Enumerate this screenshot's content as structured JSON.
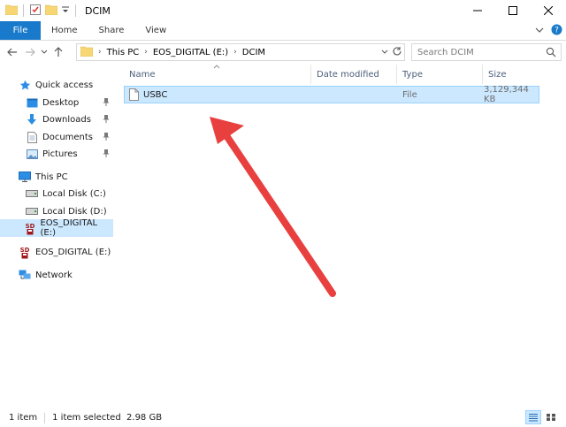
{
  "window": {
    "title": "DCIM"
  },
  "ribbon": {
    "tabs": [
      "File",
      "Home",
      "Share",
      "View"
    ]
  },
  "address": {
    "crumbs": [
      "This PC",
      "EOS_DIGITAL (E:)",
      "DCIM"
    ],
    "search_placeholder": "Search DCIM"
  },
  "nav": {
    "quick_access": "Quick access",
    "quick_items": [
      "Desktop",
      "Downloads",
      "Documents",
      "Pictures"
    ],
    "this_pc": "This PC",
    "pc_items": [
      "Local Disk (C:)",
      "Local Disk (D:)",
      "EOS_DIGITAL (E:)"
    ],
    "removable": "EOS_DIGITAL (E:)",
    "network": "Network"
  },
  "columns": [
    "Name",
    "Date modified",
    "Type",
    "Size"
  ],
  "files": [
    {
      "name": "USBC",
      "date": "",
      "type": "File",
      "size": "3,129,344 KB"
    }
  ],
  "status": {
    "count": "1 item",
    "selection": "1 item selected  2.98 GB"
  },
  "colors": {
    "accent": "#1979ca",
    "selection": "#cce8ff",
    "arrow": "#e8403f"
  }
}
